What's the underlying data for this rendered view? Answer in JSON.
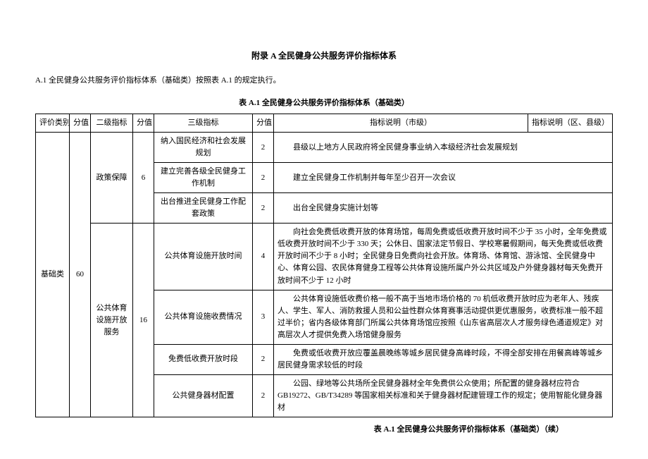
{
  "heading": "附录 A 全民健身公共服务评价指标体系",
  "intro": "A.1 全民健身公共服务评价指标体系（基础类）按照表 A.1 的规定执行。",
  "table_caption": "表 A.1 全民健身公共服务评价指标体系（基础类）",
  "table_caption_cont": "表 A.1 全民健身公共服务评价指标体系（基础类）（续）",
  "headers": {
    "col1": "评价类别",
    "col2": "分值",
    "col3": "二级指标",
    "col4": "分值",
    "col5": "三级指标",
    "col6": "分值",
    "col7": "指标说明（市级）",
    "col8": "指标说明（区、县级）"
  },
  "category": {
    "name": "基础类",
    "score": "60"
  },
  "l2": {
    "a": {
      "name": "政策保障",
      "score": "6"
    },
    "b": {
      "name": "公共体育设施开放服务",
      "score": "16"
    }
  },
  "rows": {
    "r1": {
      "l3": "纳入国民经济和社会发展规划",
      "score": "2",
      "desc": "县级以上地方人民政府将全民健身事业纳入本级经济社会发展规划"
    },
    "r2": {
      "l3": "建立完善各级全民健身工作机制",
      "score": "2",
      "desc": "建立全民健身工作机制并每年至少召开一次会议"
    },
    "r3": {
      "l3": "出台推进全民健身工作配套政策",
      "score": "2",
      "desc": "出台全民健身实施计划等"
    },
    "r4": {
      "l3": "公共体育设施开放时间",
      "score": "4",
      "desc": "向社会免费低收费开放的体育场馆，每周免费或低收费开放时间不少于 35 小时，全年免费或低收费开放时间不少于 330 天；公休日、国家法定节假日、学校寒暑假期间，每天免费或低收费开放时间不少于 8 小时；全民健身日免费向社会开放。体育场、体育馆、游泳馆、全民健身中心、体育公园、农民体育健身工程等公共体育设施所属户外公共区域及户外健身器材每天免费开放时间不少于 12 小时"
    },
    "r5": {
      "l3": "公共体育设施收费情况",
      "score": "3",
      "desc": "公共体育设施低收费价格一般不高于当地市场价格的 70 机低收费开放时应为老年人、残疾人、学生、军人、消防救援人员和公益性群众体育赛事活动提供更优惠服务，收费标准一般不超过半价；省内各级体育部门所属公共体育场馆应按照《山东省高层次人才服务绿色通道规定》对高层次人才提供免费入场馆健身服务"
    },
    "r6": {
      "l3": "免费低收费开放时段",
      "score": "2",
      "desc": "免费或低收费开放应覆盖晨晚练等城乡居民健身高峰时段，不得全部安排在用餐高峰等城乡居民健身需求较低的时段"
    },
    "r7": {
      "l3": "公共健身器材配置",
      "score": "2",
      "desc": "公园、绿地等公共场所全民健身器材全年免费供公众使用；所配置的健身器材应符合 GB19272、GB/T34289 等国家相关标准和关于健身器材配建管理工作的规定；使用智能化健身器材"
    }
  }
}
